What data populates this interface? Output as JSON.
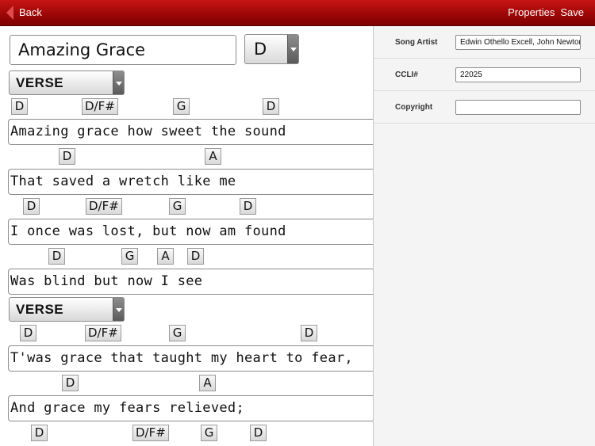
{
  "topbar": {
    "back_label": "Back",
    "properties_label": "Properties",
    "save_label": "Save",
    "bar_color": "#9a0606"
  },
  "editor": {
    "title": "Amazing Grace",
    "key": "D",
    "sections": [
      {
        "label": "VERSE"
      },
      {
        "label": "VERSE"
      }
    ],
    "lines": [
      {
        "chords": [
          "D",
          "D/F#",
          "G",
          "D"
        ],
        "lyric": "Amazing grace how sweet the sound"
      },
      {
        "chords": [
          "D",
          "A"
        ],
        "lyric": "That saved a wretch like me"
      },
      {
        "chords": [
          "D",
          "D/F#",
          "G",
          "D"
        ],
        "lyric": "I once was lost, but now am found"
      },
      {
        "chords": [
          "D",
          "G",
          "A",
          "D"
        ],
        "lyric": "Was blind but now I see"
      },
      {
        "chords": [
          "D",
          "D/F#",
          "G",
          "D"
        ],
        "lyric": "T'was grace that taught my heart to fear,"
      },
      {
        "chords": [
          "D",
          "A"
        ],
        "lyric": "And grace my fears relieved;"
      },
      {
        "chords": [
          "D",
          "D/F#",
          "G",
          "D"
        ],
        "lyric": ""
      }
    ]
  },
  "properties": {
    "song_artist_label": "Song Artist",
    "song_artist_value": "Edwin Othello Excell, John Newton",
    "ccli_label": "CCLI#",
    "ccli_value": "22025",
    "copyright_label": "Copyright",
    "copyright_value": ""
  }
}
